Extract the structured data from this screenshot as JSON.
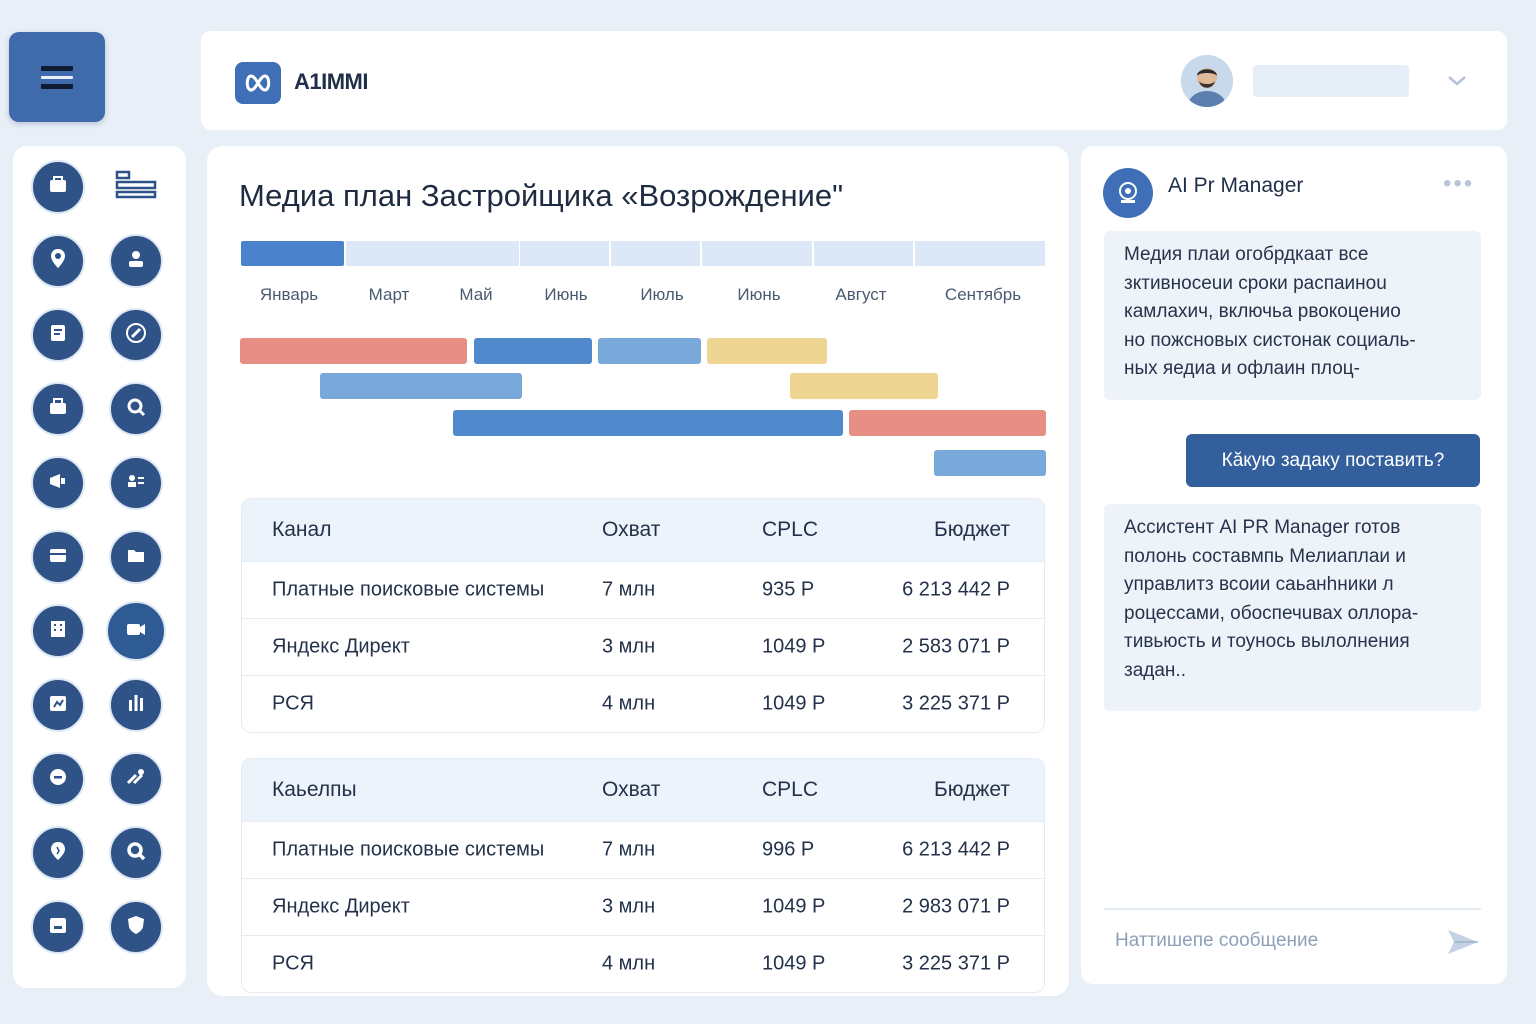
{
  "app": {
    "brand": "A1IMMI"
  },
  "colors": {
    "accent": "#3f6aac",
    "red": "#e78f85",
    "blue": "#5089cc",
    "light_blue": "#79a9db",
    "yellow": "#eed591"
  },
  "sidebar": {
    "items": [
      {
        "icon": "briefcase-icon"
      },
      {
        "icon": "list-icon"
      },
      {
        "icon": "location-pin-icon"
      },
      {
        "icon": "user-icon"
      },
      {
        "icon": "document-icon"
      },
      {
        "icon": "compass-icon"
      },
      {
        "icon": "toolbox-icon"
      },
      {
        "icon": "search-icon"
      },
      {
        "icon": "megaphone-icon"
      },
      {
        "icon": "user-list-icon"
      },
      {
        "icon": "archive-icon"
      },
      {
        "icon": "folder-icon"
      },
      {
        "icon": "building-icon"
      },
      {
        "icon": "video-icon"
      },
      {
        "icon": "chart-box-icon"
      },
      {
        "icon": "bar-chart-icon"
      },
      {
        "icon": "minus-circle-icon"
      },
      {
        "icon": "tools-icon"
      },
      {
        "icon": "pin-badge-icon"
      },
      {
        "icon": "zoom-icon"
      },
      {
        "icon": "id-card-icon"
      },
      {
        "icon": "shield-icon"
      }
    ]
  },
  "main": {
    "title": "Медиа план Застройщика «Возрождение\"",
    "months": [
      "Январь",
      "Март",
      "Май",
      "Июнь",
      "Июль",
      "Июнь",
      "Август",
      "Сентябрь"
    ],
    "timeline_active_index": 0,
    "tables": [
      {
        "headers": [
          "Канал",
          "Охват",
          "CPLC",
          "Бюджет"
        ],
        "rows": [
          [
            "Платные поисковые системы",
            "7 млн",
            "935 Р",
            "6 213 442 Р"
          ],
          [
            "Яндекс Директ",
            "3 млн",
            "1049 Р",
            "2 583 071 Р"
          ],
          [
            "РСЯ",
            "4 млн",
            "1049 Р",
            "3 225 371 Р"
          ]
        ]
      },
      {
        "headers": [
          "Каьелпы",
          "Охват",
          "CPLC",
          "Бюджет"
        ],
        "rows": [
          [
            "Платные поисковые системы",
            "7 млн",
            "996 Р",
            "6 213 442 Р"
          ],
          [
            "Яндекс Директ",
            "3 млн",
            "1049 Р",
            "2 983 071 Р"
          ],
          [
            "РСЯ",
            "4 млн",
            "1049 Р",
            "3 225 371 Р"
          ]
        ]
      }
    ]
  },
  "chat": {
    "title": "AI Pr Manager",
    "more": "•••",
    "bot_message_1": [
      "Медия плаи огобрдкаат все",
      "зктивносеuи сроки распаиноu",
      "камлахич, включьа рвокоцениo",
      "нo пожсновых систонак социаль-",
      "ных яедиа и oфлаин плоц-"
    ],
    "user_message": "Кăкую задаку поставить?",
    "bot_message_2": [
      "Ассистент AI PR Manager готов",
      "полонь составмпь Мелиаплаи и",
      "управлитз всоии саьанhники л",
      "роцессами, обоспечuвах оллора-",
      "тивьюсть и тоунось вылолнения",
      "задан.."
    ],
    "input_placeholder": "Наттишепе соoбщение"
  }
}
